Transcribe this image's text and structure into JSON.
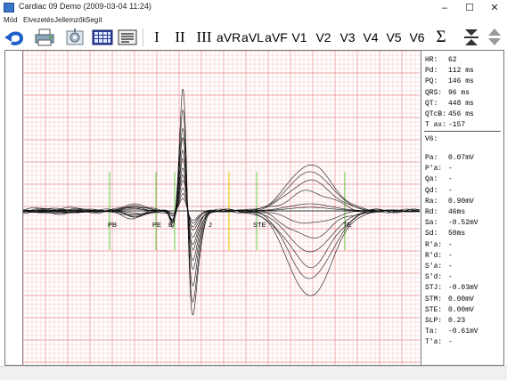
{
  "window": {
    "title": "Cardiac 09 Demo (2009-03-04 11:24)",
    "minimize": "–",
    "maximize": "☐",
    "close": "✕"
  },
  "menu": [
    "Mód",
    "Elvezetés",
    "Jellemzők",
    "Segít"
  ],
  "toolbar": {
    "icons": [
      "back-arrow-icon",
      "printer-icon",
      "settings-icon",
      "grid-icon",
      "report-icon"
    ],
    "leads": [
      "I",
      "II",
      "III",
      "aVR",
      "aVL",
      "aVF",
      "V1",
      "V2",
      "V3",
      "V4",
      "V5",
      "V6"
    ],
    "sigma": "Σ",
    "extra_icons": [
      "collapse-icon",
      "expand-icon"
    ]
  },
  "ecg": {
    "markers": [
      {
        "label": "PB",
        "color": "#66cc44"
      },
      {
        "label": "PE",
        "color": "#66cc44"
      },
      {
        "label": "B",
        "color": "#66cc44"
      },
      {
        "label": "J",
        "color": "#e6d200"
      },
      {
        "label": "STE",
        "color": "#66cc44"
      },
      {
        "label": "TE",
        "color": "#66cc44"
      }
    ],
    "grid_color": "#f4b8b8",
    "grid_major_color": "#e88a8a"
  },
  "summary": [
    {
      "label": "HR:",
      "value": "62"
    },
    {
      "label": "Pd:",
      "value": "112 ms"
    },
    {
      "label": "PQ:",
      "value": "146 ms"
    },
    {
      "label": "QRS:",
      "value": "96 ms"
    },
    {
      "label": "QT:",
      "value": "448 ms"
    },
    {
      "label": "QTcB:",
      "value": "456 ms"
    },
    {
      "label": "T ax:",
      "value": "-157"
    }
  ],
  "lead_title": "V6:",
  "lead_values": [
    {
      "label": "Pa:",
      "value": "0.07mV"
    },
    {
      "label": "P'a:",
      "value": "-"
    },
    {
      "label": "Qa:",
      "value": "-"
    },
    {
      "label": "Qd:",
      "value": "-"
    },
    {
      "label": "Ra:",
      "value": "0.90mV"
    },
    {
      "label": "Rd:",
      "value": "46ms"
    },
    {
      "label": "Sa:",
      "value": "-0.52mV"
    },
    {
      "label": "Sd:",
      "value": "50ms"
    },
    {
      "label": "R'a:",
      "value": "-"
    },
    {
      "label": "R'd:",
      "value": "-"
    },
    {
      "label": "S'a:",
      "value": "-"
    },
    {
      "label": "S'd:",
      "value": "-"
    },
    {
      "label": "STJ:",
      "value": "-0.03mV"
    },
    {
      "label": "STM:",
      "value": "0.00mV"
    },
    {
      "label": "STE:",
      "value": "0.00mV"
    },
    {
      "label": "SLP:",
      "value": "0.23"
    },
    {
      "label": "Ta:",
      "value": "-0.61mV"
    },
    {
      "label": "T'a:",
      "value": "-"
    }
  ]
}
